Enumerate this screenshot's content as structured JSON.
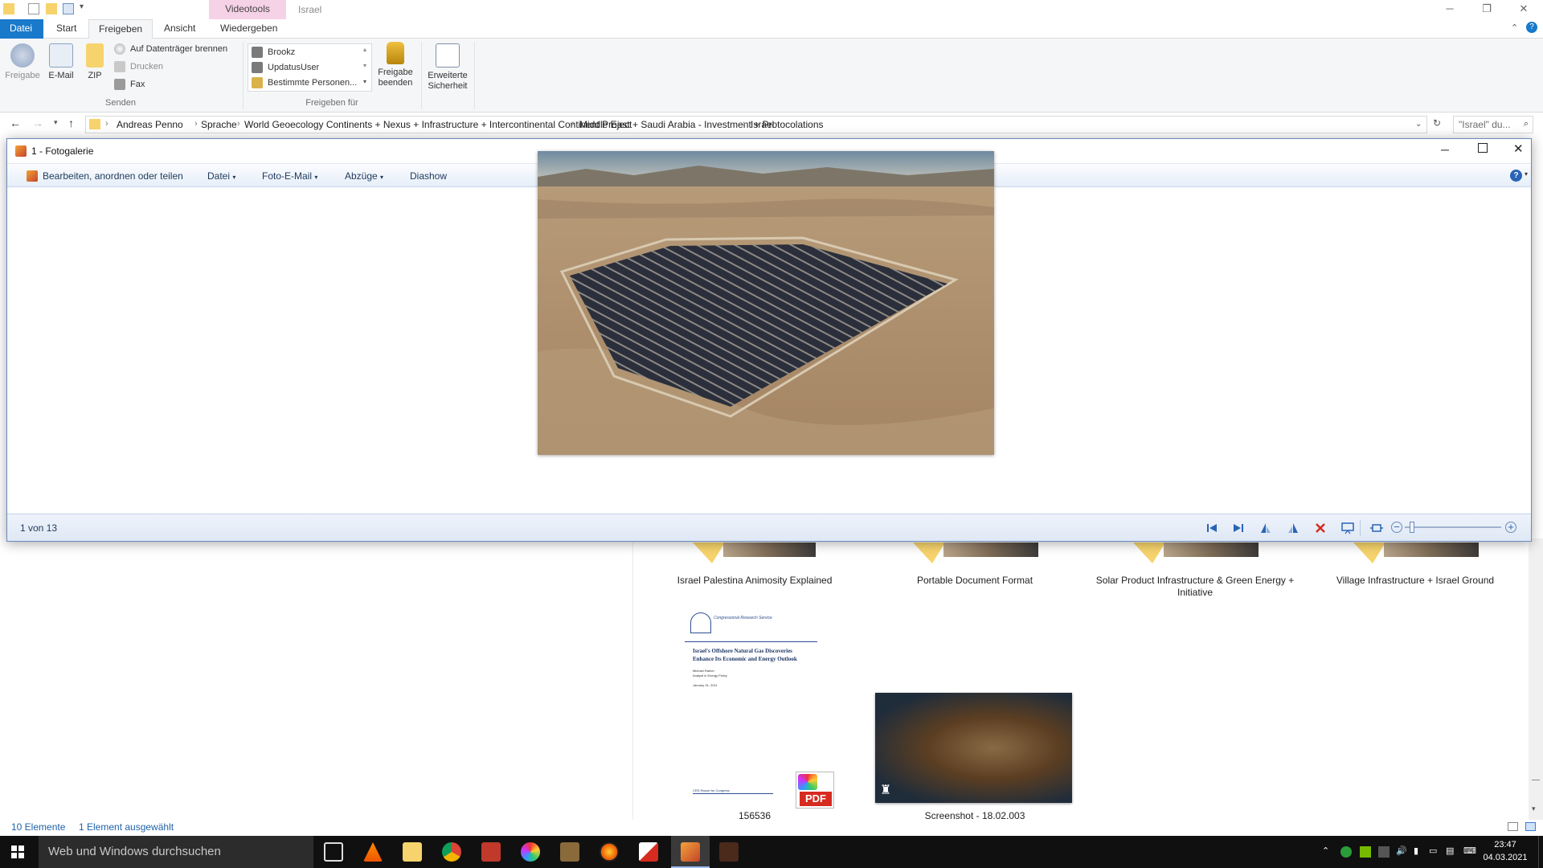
{
  "explorer": {
    "context_tab": "Videotools",
    "window_title": "Israel",
    "tabs": [
      "Datei",
      "Start",
      "Freigeben",
      "Ansicht",
      "Wiedergeben"
    ],
    "ribbon": {
      "freigabe": "Freigabe",
      "email": "E-Mail",
      "zip": "ZIP",
      "burn": "Auf Datenträger brennen",
      "print": "Drucken",
      "fax": "Fax",
      "group_senden": "Senden",
      "share_users": [
        "Brookz",
        "UpdatusUser",
        "Bestimmte Personen..."
      ],
      "group_freigeben_fuer": "Freigeben für",
      "stop_sharing": [
        "Freigabe",
        "beenden"
      ],
      "advanced_security": [
        "Erweiterte",
        "Sicherheit"
      ]
    },
    "address": {
      "crumbs": [
        "Andreas Penno",
        "Sprache",
        "World Geoecology Continents + Nexus + Infrastructure + Intercontinental Continent Project",
        "Middle East + Saudi Arabia - Investment + Protocolations",
        "Israel"
      ],
      "search_placeholder": "\"Israel\" du..."
    },
    "files": [
      {
        "name": "Israel Palestina Animosity Explained"
      },
      {
        "name": "Portable Document Format"
      },
      {
        "name": "Solar Product Infrastructure & Green Energy + Initiative"
      },
      {
        "name": "Village Infrastructure + Israel Ground"
      },
      {
        "name": "156536"
      },
      {
        "name": "Screenshot - 18.02.003"
      }
    ],
    "doc_preview": {
      "org": "Congressional Research Service",
      "title_line1": "Israel's Offshore Natural Gas Discoveries",
      "title_line2": "Enhance Its Economic and Energy Outlook",
      "author": "Michael Ratner",
      "role": "Analyst in Energy Policy",
      "date": "January 31, 2011"
    },
    "pdf_doc": {
      "label": "CRS Report for Congress",
      "badge": "PDF"
    },
    "status_items": "10 Elemente",
    "status_selected": "1 Element ausgewählt"
  },
  "gallery": {
    "title": "1 - Fotogalerie",
    "toolbar": {
      "edit": "Bearbeiten, anordnen oder teilen",
      "file": "Datei",
      "photo_email": "Foto-E-Mail",
      "prints": "Abzüge",
      "slideshow": "Diashow"
    },
    "position": "1 von 13",
    "zoom_level": 0.05
  },
  "taskbar": {
    "search_placeholder": "Web und Windows durchsuchen",
    "time": "23:47",
    "date": "04.03.2021"
  },
  "colors": {
    "file_tab": "#1979ca",
    "context_tab": "#f6d2e6",
    "gallery_border": "#6c8bbf",
    "taskbar": "#101010"
  }
}
